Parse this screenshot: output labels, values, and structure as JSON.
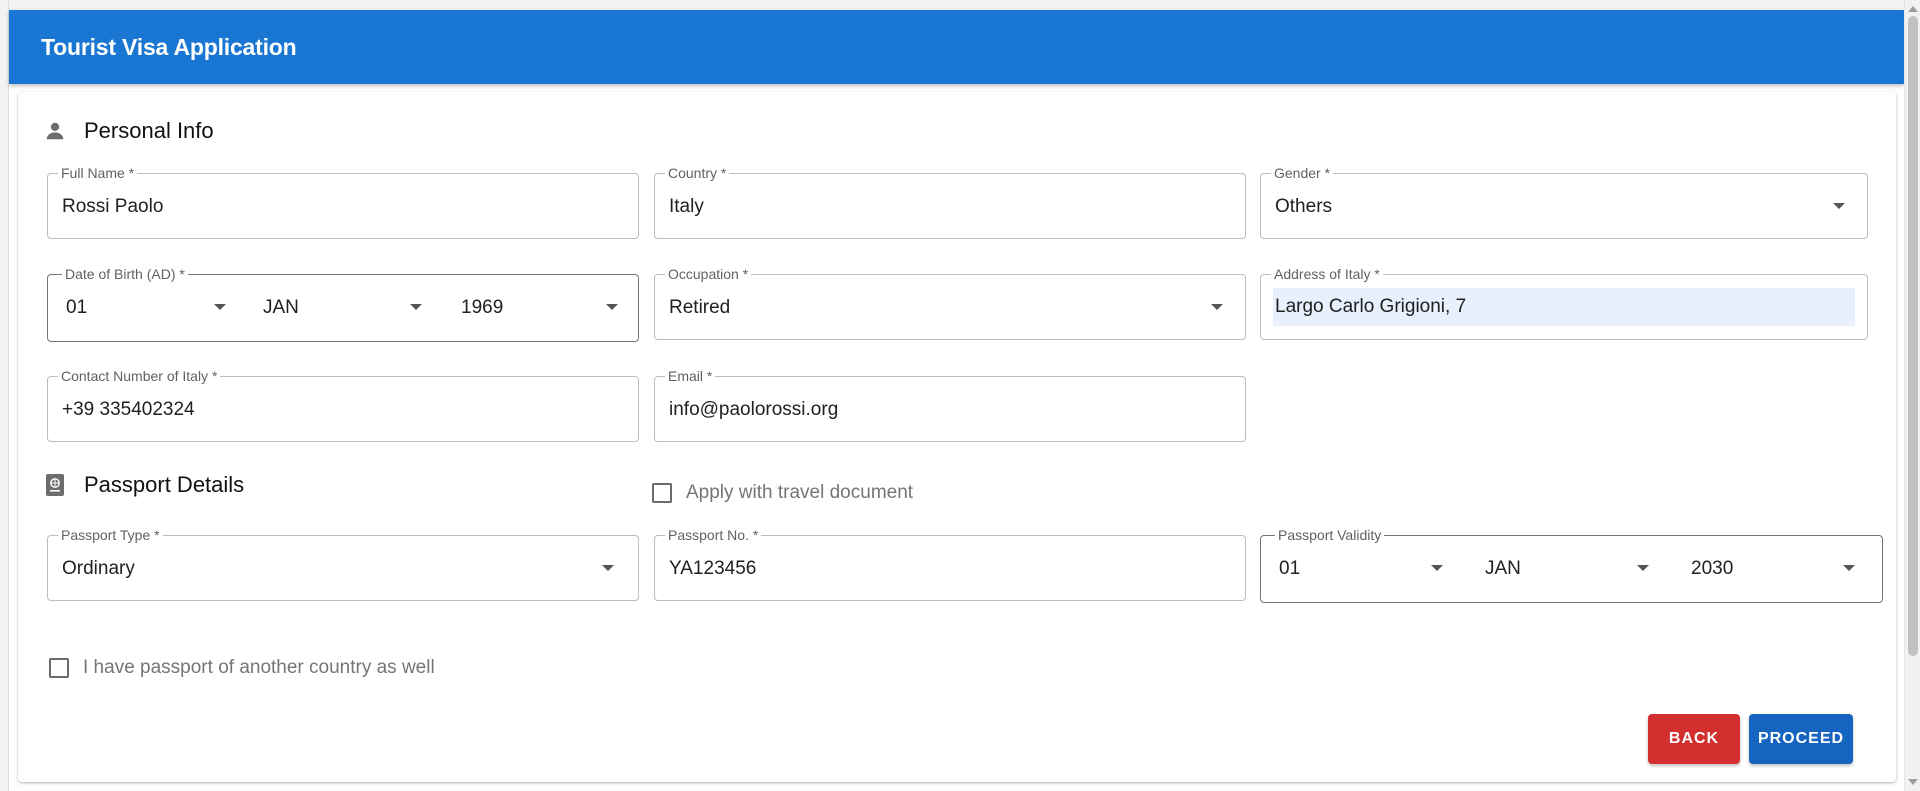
{
  "header": {
    "title": "Tourist Visa Application"
  },
  "personal_info": {
    "section_title": "Personal Info",
    "full_name": {
      "label": "Full Name *",
      "value": "Rossi Paolo"
    },
    "country": {
      "label": "Country *",
      "value": "Italy"
    },
    "gender": {
      "label": "Gender *",
      "value": "Others"
    },
    "dob": {
      "label": "Date of Birth (AD) *",
      "day": "01",
      "month": "JAN",
      "year": "1969"
    },
    "occupation": {
      "label": "Occupation *",
      "value": "Retired"
    },
    "address": {
      "label": "Address of Italy *",
      "value": "Largo Carlo Grigioni, 7"
    },
    "contact": {
      "label": "Contact Number of Italy *",
      "value": "+39 335402324"
    },
    "email": {
      "label": "Email *",
      "value": "info@paolorossi.org"
    }
  },
  "passport": {
    "section_title": "Passport Details",
    "travel_doc_checkbox": "Apply with travel document",
    "type": {
      "label": "Passport Type *",
      "value": "Ordinary"
    },
    "number": {
      "label": "Passport No. *",
      "value": "YA123456"
    },
    "validity": {
      "label": "Passport Validity",
      "day": "01",
      "month": "JAN",
      "year": "2030"
    },
    "other_country_checkbox": "I have passport of another country as well"
  },
  "actions": {
    "back": "BACK",
    "proceed": "PROCEED"
  },
  "colors": {
    "appbar": "#1976d2",
    "back": "#d32f2f",
    "proceed": "#1565c0"
  }
}
